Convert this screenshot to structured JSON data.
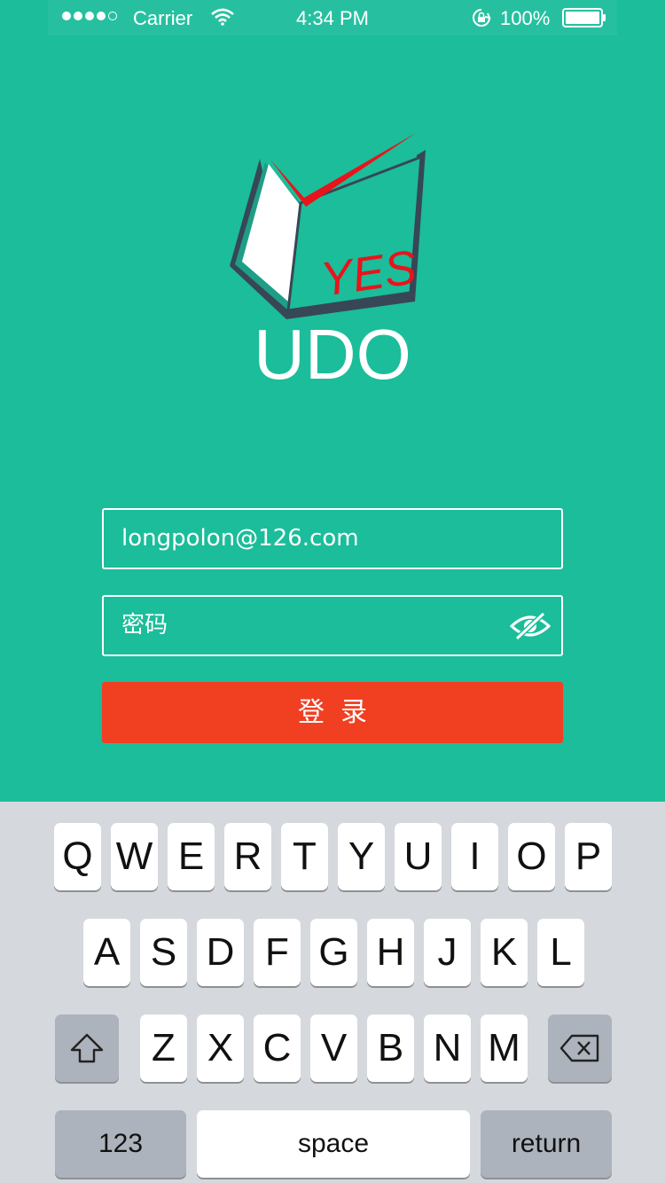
{
  "status_bar": {
    "carrier": "Carrier",
    "time": "4:34 PM",
    "battery": "100%"
  },
  "logo": {
    "badge_text": "YES",
    "brand": "UDO"
  },
  "form": {
    "email_value": "longpolon@126.com",
    "password_placeholder": "密码",
    "login_label": "登录"
  },
  "keyboard": {
    "row1": [
      "Q",
      "W",
      "E",
      "R",
      "T",
      "Y",
      "U",
      "I",
      "O",
      "P"
    ],
    "row2": [
      "A",
      "S",
      "D",
      "F",
      "G",
      "H",
      "J",
      "K",
      "L"
    ],
    "row3": [
      "Z",
      "X",
      "C",
      "V",
      "B",
      "N",
      "M"
    ],
    "numbers_label": "123",
    "space_label": "space",
    "return_label": "return"
  },
  "colors": {
    "background": "#1BBD9A",
    "login_button": "#F13F22",
    "keyboard_bg": "#D5D8DD",
    "key_bg": "#FFFFFF",
    "special_key_bg": "#ADB3BC",
    "badge_red": "#E8141B",
    "book_dark": "#374756"
  }
}
